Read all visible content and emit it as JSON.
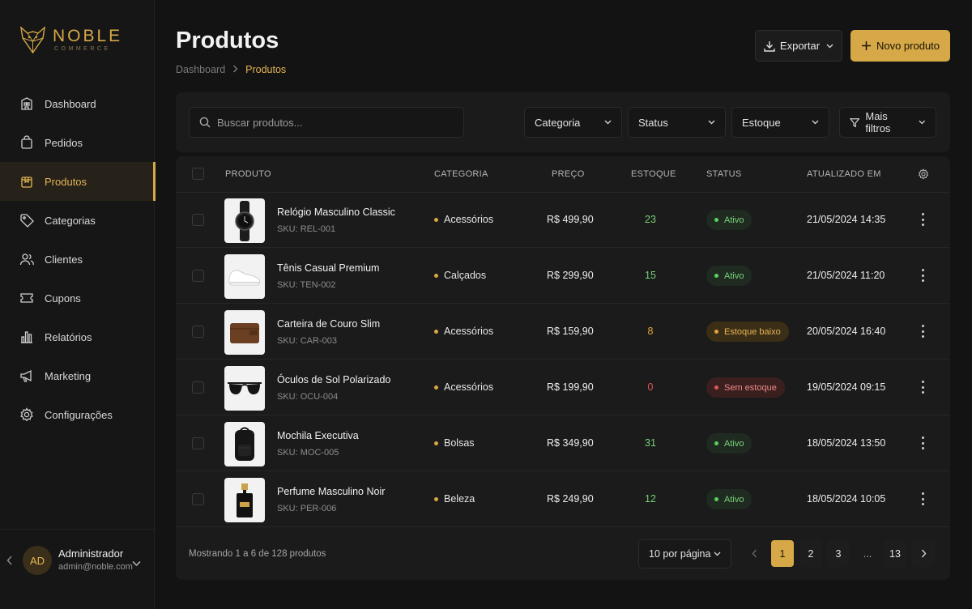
{
  "brand": {
    "name": "NOBLE",
    "tagline": "COMMERCE"
  },
  "sidebar": {
    "items": [
      {
        "label": "Dashboard",
        "icon": "dashboard-icon"
      },
      {
        "label": "Pedidos",
        "icon": "shopping-bag-icon"
      },
      {
        "label": "Produtos",
        "icon": "box-icon",
        "active": true
      },
      {
        "label": "Categorias",
        "icon": "tag-icon"
      },
      {
        "label": "Clientes",
        "icon": "users-icon"
      },
      {
        "label": "Cupons",
        "icon": "ticket-icon"
      },
      {
        "label": "Relatórios",
        "icon": "bar-chart-icon"
      },
      {
        "label": "Marketing",
        "icon": "megaphone-icon"
      },
      {
        "label": "Configurações",
        "icon": "gear-icon"
      }
    ],
    "user": {
      "initials": "AD",
      "name": "Administrador",
      "email": "admin@noble.com"
    }
  },
  "header": {
    "title": "Produtos",
    "breadcrumb": {
      "home": "Dashboard",
      "current": "Produtos"
    },
    "export_label": "Exportar",
    "new_label": "Novo produto"
  },
  "filters": {
    "search_placeholder": "Buscar produtos...",
    "category": "Categoria",
    "status": "Status",
    "stock": "Estoque",
    "more": "Mais filtros"
  },
  "table": {
    "columns": {
      "product": "PRODUTO",
      "category": "CATEGORIA",
      "price": "PREÇO",
      "stock": "ESTOQUE",
      "status": "STATUS",
      "updated": "ATUALIZADO EM"
    },
    "rows": [
      {
        "name": "Relógio Masculino Classic",
        "sku": "SKU: REL-001",
        "category": "Acessórios",
        "price": "R$ 499,90",
        "stock": "23",
        "status": "Ativo",
        "status_type": "ok",
        "updated": "21/05/2024 14:35",
        "image": "watch-image"
      },
      {
        "name": "Tênis Casual Premium",
        "sku": "SKU: TEN-002",
        "category": "Calçados",
        "price": "R$ 299,90",
        "stock": "15",
        "status": "Ativo",
        "status_type": "ok",
        "updated": "21/05/2024 11:20",
        "image": "sneaker-image"
      },
      {
        "name": "Carteira de Couro Slim",
        "sku": "SKU: CAR-003",
        "category": "Acessórios",
        "price": "R$ 159,90",
        "stock": "8",
        "status": "Estoque baixo",
        "status_type": "low",
        "updated": "20/05/2024 16:40",
        "image": "wallet-image"
      },
      {
        "name": "Óculos de Sol Polarizado",
        "sku": "SKU: OCU-004",
        "category": "Acessórios",
        "price": "R$ 199,90",
        "stock": "0",
        "status": "Sem estoque",
        "status_type": "out",
        "updated": "19/05/2024 09:15",
        "image": "sunglasses-image"
      },
      {
        "name": "Mochila Executiva",
        "sku": "SKU: MOC-005",
        "category": "Bolsas",
        "price": "R$ 349,90",
        "stock": "31",
        "status": "Ativo",
        "status_type": "ok",
        "updated": "18/05/2024 13:50",
        "image": "backpack-image"
      },
      {
        "name": "Perfume Masculino Noir",
        "sku": "SKU: PER-006",
        "category": "Beleza",
        "price": "R$ 249,90",
        "stock": "12",
        "status": "Ativo",
        "status_type": "ok",
        "updated": "18/05/2024 10:05",
        "image": "perfume-image"
      }
    ]
  },
  "footer": {
    "summary": "Mostrando 1 a 6 de 128 produtos",
    "per_page": "10 por página",
    "pages": [
      "1",
      "2",
      "3",
      "...",
      "13"
    ],
    "current_page": "1"
  },
  "colors": {
    "accent": "#d6a847",
    "ok": "#5ccf5e",
    "low": "#e9a33a",
    "out": "#e05555",
    "background": "#131313"
  }
}
